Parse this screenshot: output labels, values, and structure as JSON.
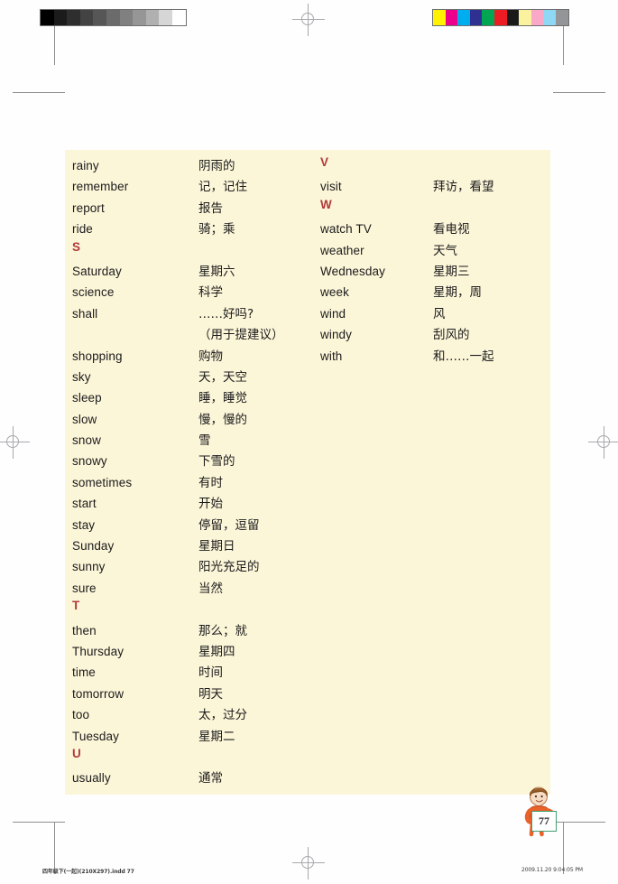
{
  "print_marks": {
    "gray_bar": {
      "name": "grayscale-step-wedge",
      "swatches": [
        "#000000",
        "#1b1b1b",
        "#2e2e2e",
        "#434343",
        "#565656",
        "#6b6b6b",
        "#808080",
        "#969696",
        "#b0b0b0",
        "#d6d6d6",
        "#ffffff"
      ]
    },
    "color_bar": {
      "name": "cmyk-color-control-bar",
      "swatches": [
        "#fff200",
        "#ec008c",
        "#00aeef",
        "#2e3192",
        "#00a651",
        "#ed1c24",
        "#1a1a1a",
        "#fbf2a0",
        "#f9a8c8",
        "#8fd8f5",
        "#939598"
      ]
    }
  },
  "wordlist": {
    "left_column": [
      {
        "type": "entry",
        "term": "rainy",
        "gloss": "阴雨的"
      },
      {
        "type": "entry",
        "term": "remember",
        "gloss": "记，记住"
      },
      {
        "type": "entry",
        "term": "report",
        "gloss": "报告"
      },
      {
        "type": "entry",
        "term": "ride",
        "gloss": "骑；乘"
      },
      {
        "type": "letter",
        "term": "S"
      },
      {
        "type": "entry",
        "term": "Saturday",
        "gloss": "星期六"
      },
      {
        "type": "entry",
        "term": "science",
        "gloss": "科学"
      },
      {
        "type": "entry",
        "term": "shall",
        "gloss": "……好吗?"
      },
      {
        "type": "cont",
        "term": "shall",
        "gloss": "（用于提建议）"
      },
      {
        "type": "entry",
        "term": "shopping",
        "gloss": "购物"
      },
      {
        "type": "entry",
        "term": "sky",
        "gloss": "天，天空"
      },
      {
        "type": "entry",
        "term": "sleep",
        "gloss": "睡，睡觉"
      },
      {
        "type": "entry",
        "term": "slow",
        "gloss": "慢，慢的"
      },
      {
        "type": "entry",
        "term": "snow",
        "gloss": "雪"
      },
      {
        "type": "entry",
        "term": "snowy",
        "gloss": "下雪的"
      },
      {
        "type": "entry",
        "term": "sometimes",
        "gloss": "有时"
      },
      {
        "type": "entry",
        "term": "start",
        "gloss": "开始"
      },
      {
        "type": "entry",
        "term": "stay",
        "gloss": "停留，逗留"
      },
      {
        "type": "entry",
        "term": "Sunday",
        "gloss": "星期日"
      },
      {
        "type": "entry",
        "term": "sunny",
        "gloss": "阳光充足的"
      },
      {
        "type": "entry",
        "term": "sure",
        "gloss": "当然"
      },
      {
        "type": "letter",
        "term": "T"
      },
      {
        "type": "entry",
        "term": "then",
        "gloss": "那么；就"
      },
      {
        "type": "entry",
        "term": "Thursday",
        "gloss": "星期四"
      },
      {
        "type": "entry",
        "term": "time",
        "gloss": "时间"
      },
      {
        "type": "entry",
        "term": "tomorrow",
        "gloss": "明天"
      },
      {
        "type": "entry",
        "term": "too",
        "gloss": "太，过分"
      },
      {
        "type": "entry",
        "term": "Tuesday",
        "gloss": "星期二"
      },
      {
        "type": "letter",
        "term": "U"
      },
      {
        "type": "entry",
        "term": "usually",
        "gloss": "通常"
      }
    ],
    "right_column": [
      {
        "type": "letter",
        "term": "V"
      },
      {
        "type": "entry",
        "term": "visit",
        "gloss": "拜访，看望"
      },
      {
        "type": "letter",
        "term": "W"
      },
      {
        "type": "entry",
        "term": "watch TV",
        "gloss": "看电视"
      },
      {
        "type": "entry",
        "term": "weather",
        "gloss": "天气"
      },
      {
        "type": "entry",
        "term": "Wednesday",
        "gloss": "星期三"
      },
      {
        "type": "entry",
        "term": "week",
        "gloss": "星期，周"
      },
      {
        "type": "entry",
        "term": "wind",
        "gloss": "风"
      },
      {
        "type": "entry",
        "term": "windy",
        "gloss": "刮风的"
      },
      {
        "type": "entry",
        "term": "with",
        "gloss": "和……一起"
      }
    ]
  },
  "page": {
    "number": "77"
  },
  "footer": {
    "file": "四年级下(一起)(210X297).indd   77",
    "timestamp": "2009.11.20   9:04:05 PM"
  },
  "colors": {
    "panel_background": "#fcf6d9",
    "section_letter": "#b03a3a",
    "text": "#1b1b1b",
    "badge_border": "#3f9e6e"
  }
}
